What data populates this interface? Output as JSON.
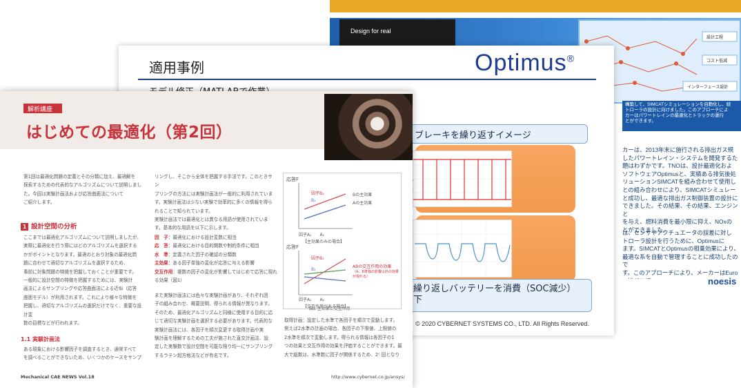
{
  "back_page": {
    "design_label": "Design for real",
    "screen_labels": [
      "設計工程",
      "コスト低減",
      "インターフェース設計"
    ],
    "caption": "構築して、SIMCATシミュレーションを自動化し、続\nトローラの設計に向けました。このアプローチによ\nカーはパワートレインの最適化とトラックの運行\nとができます。",
    "caption_num": "1",
    "body_text": "カーは、2013年末に施行される排出ガス規\nしたパワートレイン・システムを開発するた\n題はわずかです。TNOは、設計最適化およ\nソフトウェアOptimusと、実績ある排気後処\nリューションSIMCATを組み合わせて使用し\nとの組み合わせにより、SIMCATシミュレー\nと成功し、最適な排出ガス制御装置の設計に\nできました。その結果、その結果、エンジンと\nを与え、燃料消費を最小限に抑え、NOxの\nとができました。",
    "body_text2": "は、センサやアクチュエータの誤差に対し\nトローラ設計を行うために、Optimusに\nます。SIMCATとOptimusの相乗効果により、\n最適な系を自動で管理することに成功したので\nす。このアプローチにより、メーカーはEuro VI排ガス規\n制要件を満たす、低コストで満たすことができるようにな",
    "logo": "noesis"
  },
  "mid_page": {
    "title": "適用事例",
    "logo": "Optimus",
    "logo_mark": "®",
    "subtitle": "モデル修正（MATLABで作業）",
    "box1_label": "ブレーキを繰り返すイメージ",
    "box1_fragment_a": "充",
    "box1_fragment_b": "下",
    "box2_label_line1": "繰り返しバッテリーを消費（SOC減少）",
    "box2_label_line2": "下",
    "copyright": "© 2020 CYBERNET SYSTEMS CO., LTD. All Rights Reserved."
  },
  "front_page": {
    "tag": "解析講座",
    "title": "はじめての最適化（第2回）",
    "col1_text": "第1回は最適化問題の定義とその分類に加え、最適解を\n探索するための代表的なアルゴリズムについて説明しまし\nた。今回は実験計画法および応答曲面法について\nご紹介します。",
    "section_num": "1",
    "section_title": "設計空間の分析",
    "col1b_text": "ここまでは最適化アルゴリズムについて説明しましたが、\n実際に最適化を行う際にはどのアルゴリズムを選択する\nかがポイントとなります。最適のとおり対象の最適化問\n題に合わせて適切なアルゴリズムを選択するため、\n事前に対象問題の特徴を把握しておくことが重要です。\n一般的に設計空間の特徴を把握するためには、実験計\n画法によるサンプリングや応答曲面法による近似（応答\n曲面モデル）が利用されます。これにより様々な特徴を\n把握し、適切なアルゴリズムの選択だけでなく、重要な設計変\n数の目標などが行われます。",
    "subsec_title": "1.1 実験計画法",
    "col1c_text": "ある現象における影響因子を調査するとき、通常すべて\nを調べることができないため、いくつかのケースをサンプ",
    "col2_text": "リングし、そこから全体を把握する手法です。このときサン\nプリングの方法には実験計画法が一般的に利用されていま\nす。実験計画法は少ない実験で効率的に多くの情報を得ら\nれることで知られています。\n実験計画法では最適化とは異なる用語が使用されていま\nす。基本的な用語を以下に示します。",
    "terms": [
      {
        "term": "因　子",
        "desc": "：最適化における設計変数に相当"
      },
      {
        "term": "応　答",
        "desc": "：最適化における目的関数や制約条件に相当"
      },
      {
        "term": "水　準",
        "desc": "：定義された因子の確認の分類数"
      },
      {
        "term": "主効果",
        "desc": "：ある因子単独の変化が応答に与える影響"
      },
      {
        "term": "交互作用",
        "desc": "：複数の因子の変化が影響してはじめて応答に現れる効果（図1）"
      }
    ],
    "col2_tail": "また実験計画法には色々な実験計画があり、それぞれ因\n子の組み合わせ、概要説明、得られる情報が異なります。\nそのため、最適化アルゴリズムと同様に使用する目的に応\nじて適切な実験計画を選択する必要があります。代表的な\n実験計画法には、各因子を順次変更する取得計画や実\n験計画を理解するための工夫が施された直交計画法、設\n定した実験数で設計空間を可能な限り均一にサンプリング\nするラテン超方格法などが有名です。",
    "figure": {
      "top_ylabel": "応答F",
      "top_series": [
        {
          "name": "因子B₁"
        },
        {
          "name": "B₂"
        },
        {
          "name": "Bの主効果"
        },
        {
          "name": "Aの主効果"
        }
      ],
      "top_xlabel": "因子A₁　　A₂",
      "top_caption": "【主効果のみの場合】",
      "bottom_ylabel": "応答F",
      "bottom_series": [
        {
          "name": "因子B₁"
        },
        {
          "name": "B₂"
        },
        {
          "name": "ABの交互作用の効果"
        },
        {
          "name": "（A、B単独の影響以外の効果が現れる）"
        }
      ],
      "bottom_xlabel": "因子A₁　　A₂",
      "bottom_caption": "【交互作用がある場合】",
      "caption": "図1 主効果と交互作用"
    },
    "col3_text": "取得計画：設定した水準で各因子を順次で変動します。\n例えば2水準の計画の場合、各因子の下限値、上限値の\n2水準を順次で変動します。得られる情報は各因子の1\nつの効果と交互作用の効果を評価することができます。最\n大で組数は、水準数に因子が関係するため、2ⁿ 回となり",
    "footer_left": "Mechanical CAE NEWS  Vol.18",
    "footer_right": "http://www.cybernet.co.jp/ansys/"
  },
  "colors": {
    "accent_red": "#c8323a",
    "optimus_blue": "#1d3c8f",
    "orange": "#f39a4f",
    "brochure_blue": "#1c5aa8",
    "top_bar": "#e9a825"
  }
}
